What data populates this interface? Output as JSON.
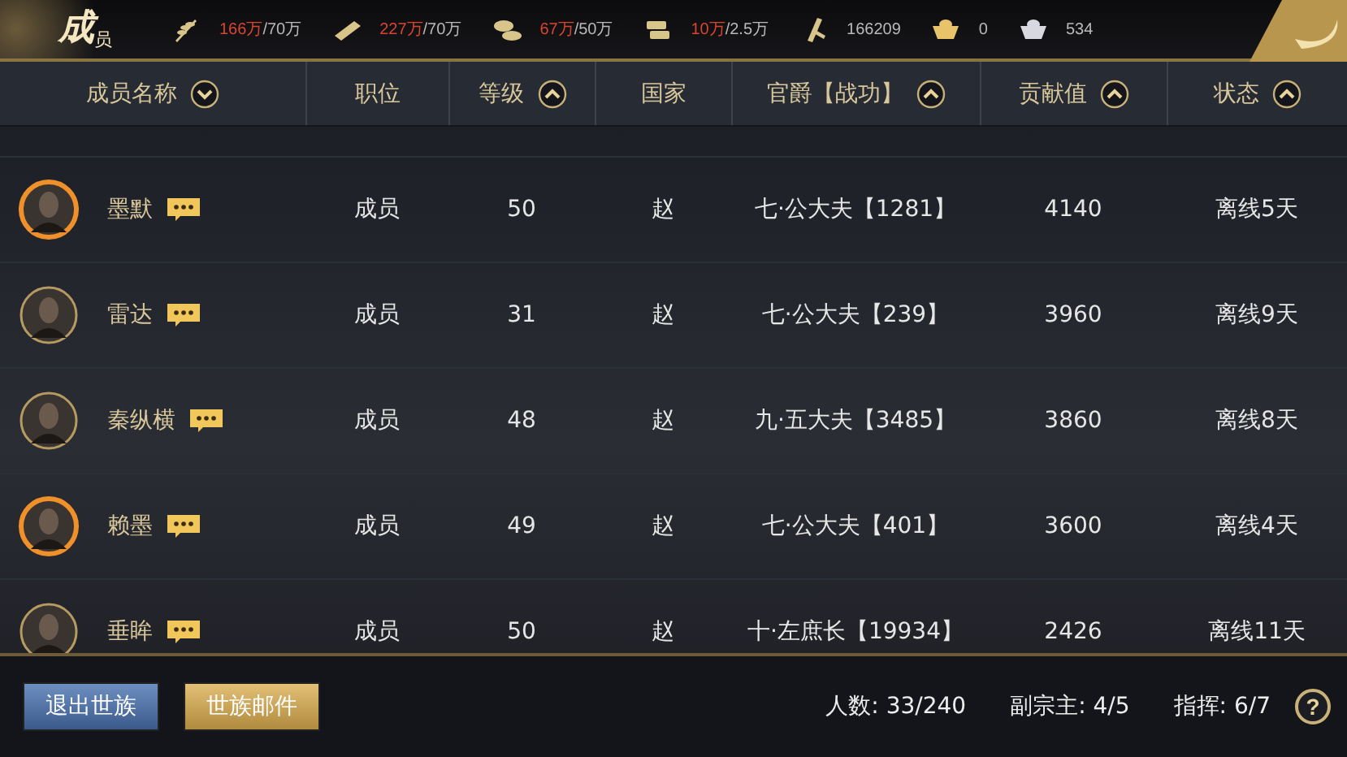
{
  "title": {
    "main": "成",
    "sub": "员"
  },
  "resources": [
    {
      "kind": "grain",
      "current": "166万",
      "cap": "/70万"
    },
    {
      "kind": "wood",
      "current": "227万",
      "cap": "/70万"
    },
    {
      "kind": "stone",
      "current": "67万",
      "cap": "/50万"
    },
    {
      "kind": "iron",
      "current": "10万",
      "cap": "/2.5万"
    },
    {
      "kind": "token",
      "value": "166209"
    },
    {
      "kind": "gold",
      "value": "0"
    },
    {
      "kind": "silver",
      "value": "534"
    }
  ],
  "columns": [
    {
      "label": "成员名称",
      "kind": "down"
    },
    {
      "label": "职位",
      "kind": "plain"
    },
    {
      "label": "等级",
      "kind": "up"
    },
    {
      "label": "国家",
      "kind": "plain"
    },
    {
      "label": "官爵【战功】",
      "kind": "up"
    },
    {
      "label": "贡献值",
      "kind": "up"
    },
    {
      "label": "状态",
      "kind": "up"
    }
  ],
  "rows": [
    {
      "name": "墨默",
      "kind": "flame",
      "role": "成员",
      "level": "50",
      "country": "赵",
      "rank": "七·公大夫【1281】",
      "contribution": "4140",
      "status": "离线5天"
    },
    {
      "name": "雷达",
      "kind": "plain",
      "role": "成员",
      "level": "31",
      "country": "赵",
      "rank": "七·公大夫【239】",
      "contribution": "3960",
      "status": "离线9天"
    },
    {
      "name": "秦纵横",
      "kind": "plain",
      "role": "成员",
      "level": "48",
      "country": "赵",
      "rank": "九·五大夫【3485】",
      "contribution": "3860",
      "status": "离线8天"
    },
    {
      "name": "赖墨",
      "kind": "flame",
      "role": "成员",
      "level": "49",
      "country": "赵",
      "rank": "七·公大夫【401】",
      "contribution": "3600",
      "status": "离线4天"
    },
    {
      "name": "垂眸",
      "kind": "plain",
      "role": "成员",
      "level": "50",
      "country": "赵",
      "rank": "十·左庶长【19934】",
      "contribution": "2426",
      "status": "离线11天"
    }
  ],
  "footer": {
    "buttons": [
      "退出世族",
      "世族邮件"
    ],
    "stats": [
      "人数: 33/240",
      "副宗主: 4/5",
      "指挥: 6/7"
    ],
    "help": "?"
  }
}
